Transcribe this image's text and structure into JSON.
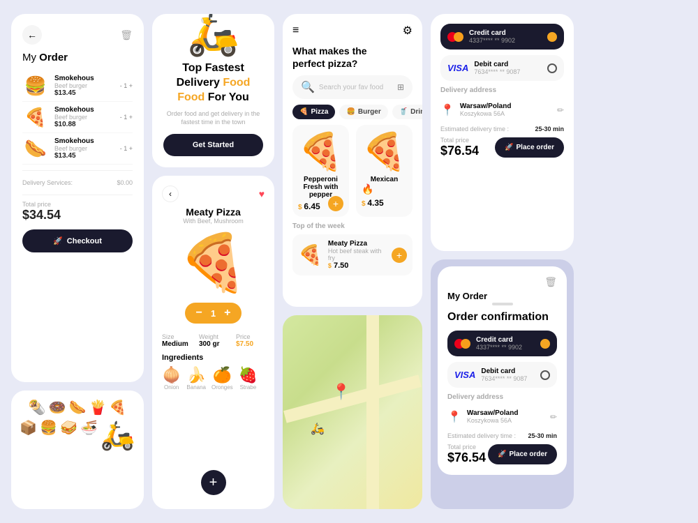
{
  "col1": {
    "my_order_title": "My",
    "my_order_bold": "Order",
    "items": [
      {
        "emoji": "🍔",
        "name": "Smokehous",
        "sub": "Beef burger",
        "price": "$13.45",
        "qty": "- 1 +"
      },
      {
        "emoji": "🍕",
        "name": "Smokehous",
        "sub": "Beef burger",
        "price": "$10.88",
        "qty": "- 1 +"
      },
      {
        "emoji": "🌭",
        "name": "Smokehous",
        "sub": "Beef burger",
        "price": "$13.45",
        "qty": "- 1 +"
      }
    ],
    "delivery_label": "Delivery Services:",
    "delivery_price": "$0.00",
    "total_label": "Total price",
    "total_amount": "$34.54",
    "checkout_label": "Checkout",
    "food_icons": [
      "🌯",
      "🍩",
      "🌭",
      "🍟",
      "🍕",
      "📦",
      "🍔",
      "🥪",
      "🍜",
      "🛵"
    ]
  },
  "col2": {
    "banner": {
      "emoji": "🛵",
      "title_line1": "Top Fastest",
      "title_line2": "Delivery",
      "highlight": "Food",
      "title_line3": "For You",
      "sub": "Order food and get delivery in the fastest time in the town",
      "btn_label": "Get Started"
    },
    "pizza_detail": {
      "pizza_name": "Meaty Pizza",
      "pizza_sub": "With Beef, Mushroom",
      "emoji": "🍕",
      "qty": "1",
      "size_label": "Size",
      "size_val": "Medium",
      "weight_label": "Weight",
      "weight_val": "300 gr",
      "price_label": "Price",
      "price_val": "$7.50",
      "ingredients_title": "Ingredients",
      "ingredients": [
        {
          "emoji": "🧅",
          "label": "Onion"
        },
        {
          "emoji": "🍌",
          "label": "Banana"
        },
        {
          "emoji": "🍊",
          "label": "Oronges"
        },
        {
          "emoji": "🍓",
          "label": "Strabe"
        }
      ],
      "add_btn": "+"
    }
  },
  "col3": {
    "app": {
      "title1": "What makes the",
      "title2_bold": "perfect pizza?",
      "search_placeholder": "Search your fav food",
      "categories": [
        {
          "emoji": "🍕",
          "label": "Pizza",
          "active": true
        },
        {
          "emoji": "🍔",
          "label": "Burger",
          "active": false
        },
        {
          "emoji": "🥤",
          "label": "Drink",
          "active": false
        }
      ],
      "featured": [
        {
          "emoji": "🍕",
          "name": "Pepperoni Fresh with pepper",
          "price": "6.45",
          "price_sym": "$",
          "badge": ""
        },
        {
          "emoji": "🍕",
          "name": "Mexican",
          "price": "4.35",
          "price_sym": "$",
          "badge": "🔥"
        }
      ],
      "week_title": "Top of the week",
      "week_item": {
        "emoji": "🍕",
        "name": "Meaty Pizza",
        "sub": "Hot beef steak with fry",
        "price": "7.50",
        "price_sym": "$"
      }
    }
  },
  "col4": {
    "payment": {
      "title": "Order confirmation",
      "options": [
        {
          "type": "Credit card",
          "number": "4337**** ** 9902",
          "selected": true
        },
        {
          "type": "Debit card",
          "number": "7634**** ** 9087",
          "selected": false
        }
      ],
      "delivery_title": "Delivery address",
      "location": "Warsaw/Poland",
      "street": "Koszykowa 56A",
      "est_label": "Estimated  delivery time :",
      "est_val": "25-30 min",
      "total_label": "Total price",
      "total_amount": "$76.54",
      "place_order_label": "Place order"
    },
    "order_confirm": {
      "my_order": "My Order",
      "title": "Order confirmation",
      "options": [
        {
          "type": "Credit card",
          "number": "4337**** ** 9902",
          "selected": true
        },
        {
          "type": "Debit card",
          "number": "7634**** ** 9087",
          "selected": false
        }
      ],
      "delivery_title": "Delivery address",
      "location": "Warsaw/Poland",
      "street": "Koszykowa 56A",
      "est_label": "Estimated  delivery time :",
      "est_val": "25-30 min",
      "total_label": "Total price",
      "total_amount": "$76.54",
      "place_order_label": "Place order"
    }
  }
}
